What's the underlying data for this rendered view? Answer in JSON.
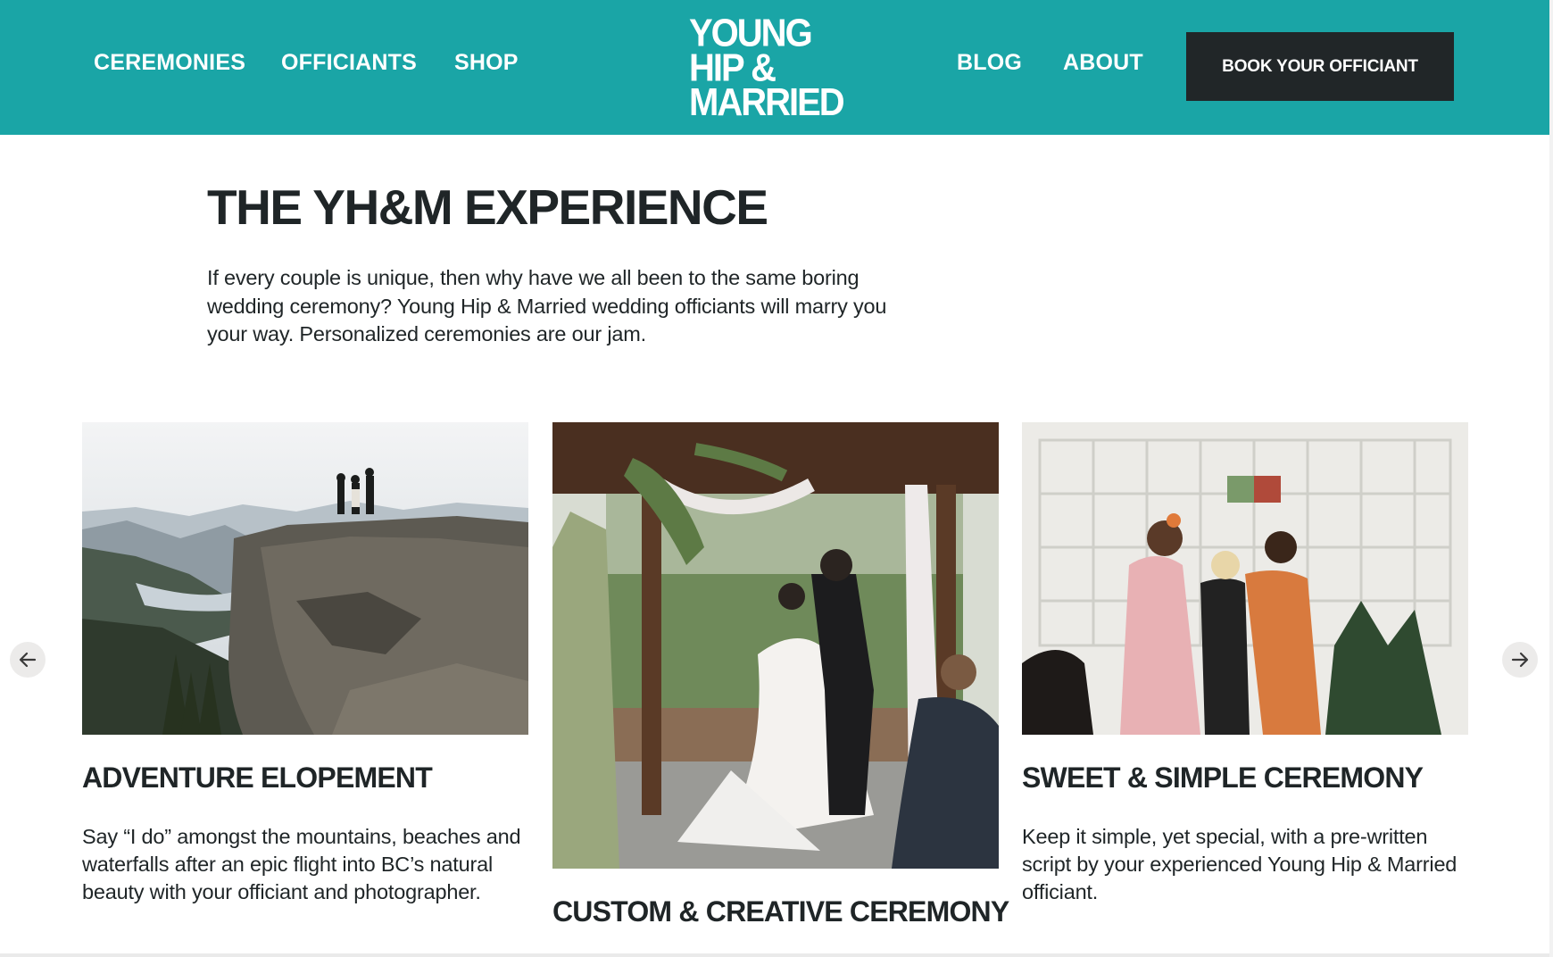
{
  "header": {
    "nav_left": [
      "CEREMONIES",
      "OFFICIANTS",
      "SHOP"
    ],
    "nav_right": [
      "BLOG",
      "ABOUT"
    ],
    "logo_lines": [
      "YOUNG",
      "HIP &",
      "MARRIED"
    ],
    "cta_label": "BOOK YOUR OFFICIANT",
    "brand_color": "#1aa5a6",
    "cta_color": "#212628"
  },
  "intro": {
    "title": "THE YH&M EXPERIENCE",
    "body": "If every couple is unique, then why have we all been to the same boring wedding ceremony? Young Hip & Married wedding officiants will marry you your way. Personalized ceremonies are our jam."
  },
  "carousel": {
    "prev_icon": "arrow-left-icon",
    "next_icon": "arrow-right-icon",
    "cards": [
      {
        "title": "ADVENTURE ELOPEMENT",
        "text": "Say “I do” amongst the mountains, beaches and waterfalls after an epic flight into BC’s natural beauty with your officiant and photographer."
      },
      {
        "title": "CUSTOM & CREATIVE CEREMONY",
        "text": ""
      },
      {
        "title": "SWEET & SIMPLE CEREMONY",
        "text": "Keep it simple, yet special, with a pre-written script by your experienced Young Hip & Married officiant."
      }
    ]
  }
}
